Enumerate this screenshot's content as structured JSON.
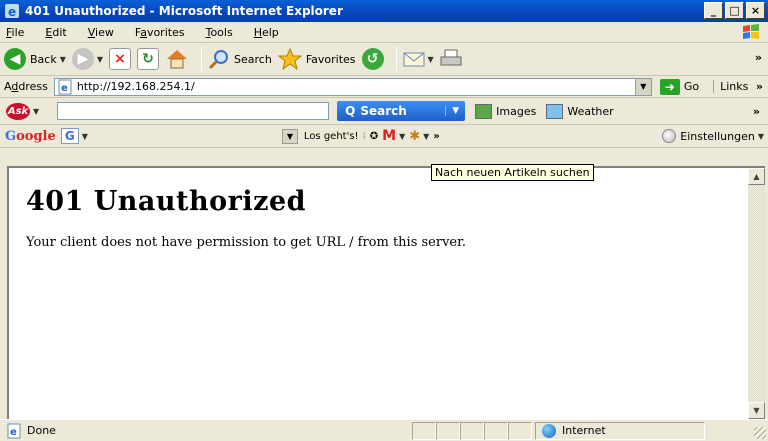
{
  "window": {
    "title": "401 Unauthorized - Microsoft Internet Explorer",
    "min": "_",
    "max": "□",
    "close": "×"
  },
  "menu": [
    {
      "key": "F",
      "rest": "ile"
    },
    {
      "key": "E",
      "rest": "dit"
    },
    {
      "key": "V",
      "rest": "iew"
    },
    {
      "pre": "F",
      "key": "a",
      "rest": "vorites"
    },
    {
      "key": "T",
      "rest": "ools"
    },
    {
      "key": "H",
      "rest": "elp"
    }
  ],
  "toolbar": {
    "back": "Back",
    "search": "Search",
    "favorites": "Favorites",
    "more": "»"
  },
  "address": {
    "label_pre": "A",
    "label_key": "d",
    "label_post": "dress",
    "url": "http://192.168.254.1/",
    "go": "Go",
    "links": "Links",
    "links_more": "»"
  },
  "ask": {
    "logo": "Ask",
    "search_label": "Search",
    "search_glyph": "Q",
    "images": "Images",
    "weather": "Weather",
    "more": "»"
  },
  "google": {
    "logo_g": "G",
    "logo_rest": "oogle",
    "g_button": "G",
    "go_label": "Los geht's!",
    "more": "»",
    "settings": "Einstellungen"
  },
  "tooltip": "Nach neuen Artikeln suchen",
  "page": {
    "heading": "401 Unauthorized",
    "message": "Your client does not have permission to get URL / from this server."
  },
  "status": {
    "text": "Done",
    "zone": "Internet"
  }
}
